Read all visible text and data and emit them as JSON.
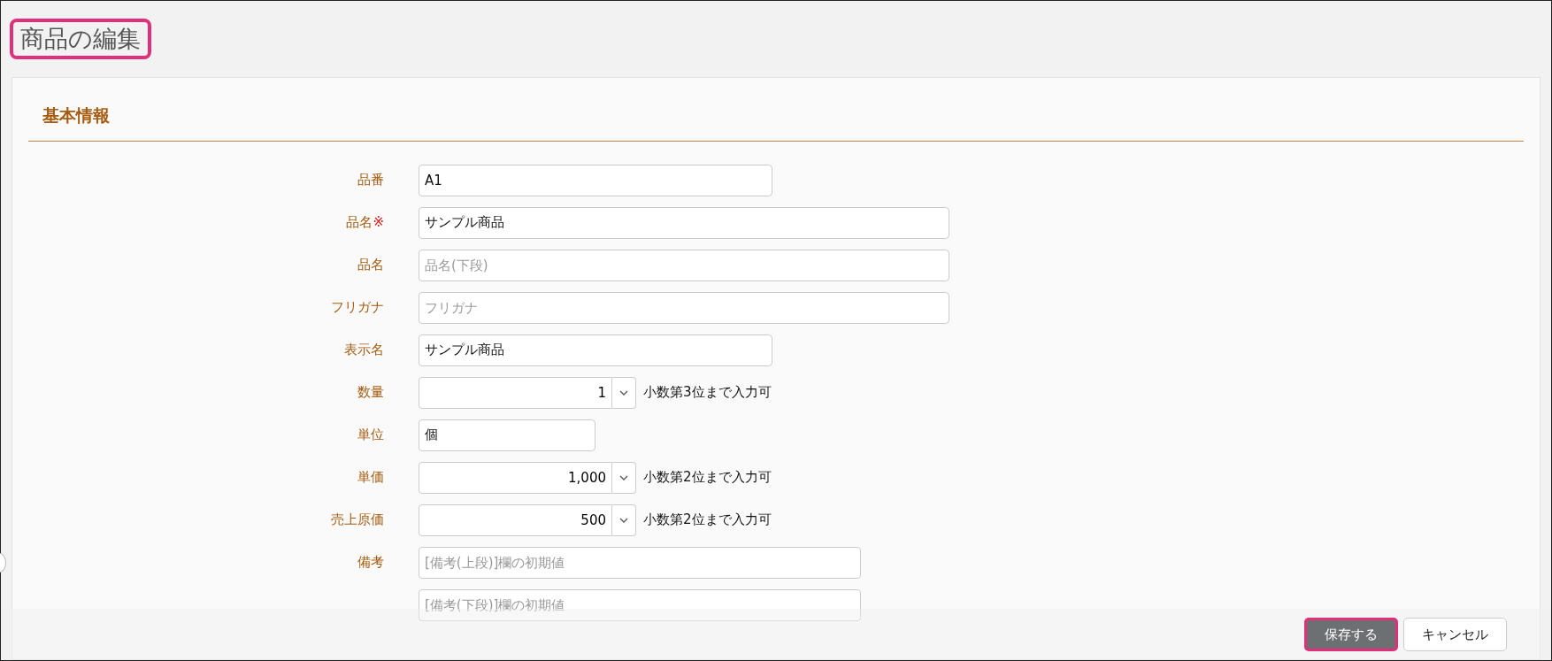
{
  "page": {
    "title": "商品の編集",
    "highlighted": true
  },
  "section": {
    "heading": "基本情報"
  },
  "fields": [
    {
      "kind": "text",
      "label": "品番",
      "value": "A1"
    },
    {
      "kind": "text",
      "label": "品名",
      "mark": "※",
      "value": "サンプル商品"
    },
    {
      "kind": "text",
      "label": "品名",
      "placeholder": "品名(下段)"
    },
    {
      "kind": "text",
      "label": "フリガナ",
      "placeholder": "フリガナ"
    },
    {
      "kind": "text",
      "label": "表示名",
      "value": "サンプル商品"
    },
    {
      "kind": "number",
      "label": "数量",
      "value": "1",
      "hint": "小数第3位まで入力可"
    },
    {
      "kind": "text",
      "label": "単位",
      "value": "個"
    },
    {
      "kind": "number",
      "label": "単価",
      "value": "1,000",
      "hint": "小数第2位まで入力可"
    },
    {
      "kind": "number",
      "label": "売上原価",
      "value": "500",
      "hint": "小数第2位まで入力可"
    },
    {
      "kind": "text",
      "label": "備考",
      "placeholder": "[備考(上段)]欄の初期値"
    },
    {
      "kind": "text",
      "placeholder": "[備考(下段)]欄の初期値"
    }
  ],
  "footer": {
    "buttons": [
      {
        "label": "保存する",
        "kind": "primary",
        "highlighted": true
      },
      {
        "label": "キャンセル",
        "kind": "secondary",
        "highlighted": false
      }
    ]
  }
}
